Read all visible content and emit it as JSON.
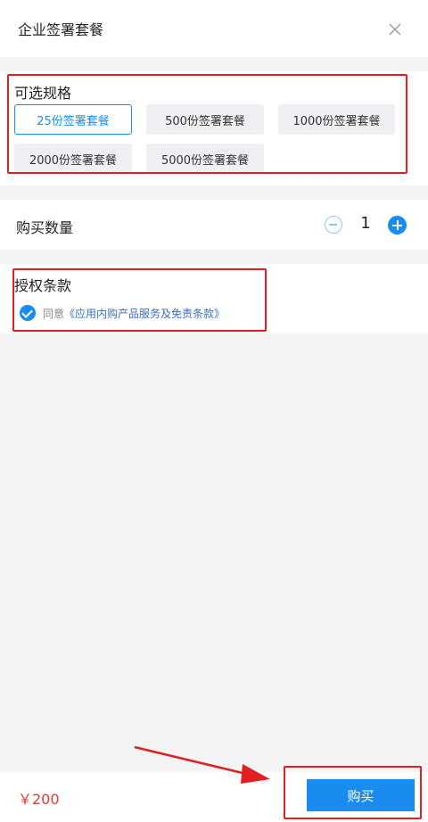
{
  "header": {
    "title": "企业签署套餐",
    "close_icon": "close-icon"
  },
  "spec": {
    "title": "可选规格",
    "options": [
      {
        "label": "25份签署套餐",
        "selected": true
      },
      {
        "label": "500份签署套餐",
        "selected": false
      },
      {
        "label": "1000份签署套餐",
        "selected": false
      },
      {
        "label": "2000份签署套餐",
        "selected": false
      },
      {
        "label": "5000份签署套餐",
        "selected": false
      }
    ]
  },
  "quantity": {
    "label": "购买数量",
    "value": "1"
  },
  "terms": {
    "title": "授权条款",
    "agree_prefix": "同意",
    "link_text": "《应用内购产品服务及免责条款》",
    "checked": true
  },
  "footer": {
    "price": "￥200",
    "buy_label": "购买"
  },
  "colors": {
    "accent": "#1a8cf0",
    "price": "#e53935",
    "annotation": "#e02020"
  }
}
